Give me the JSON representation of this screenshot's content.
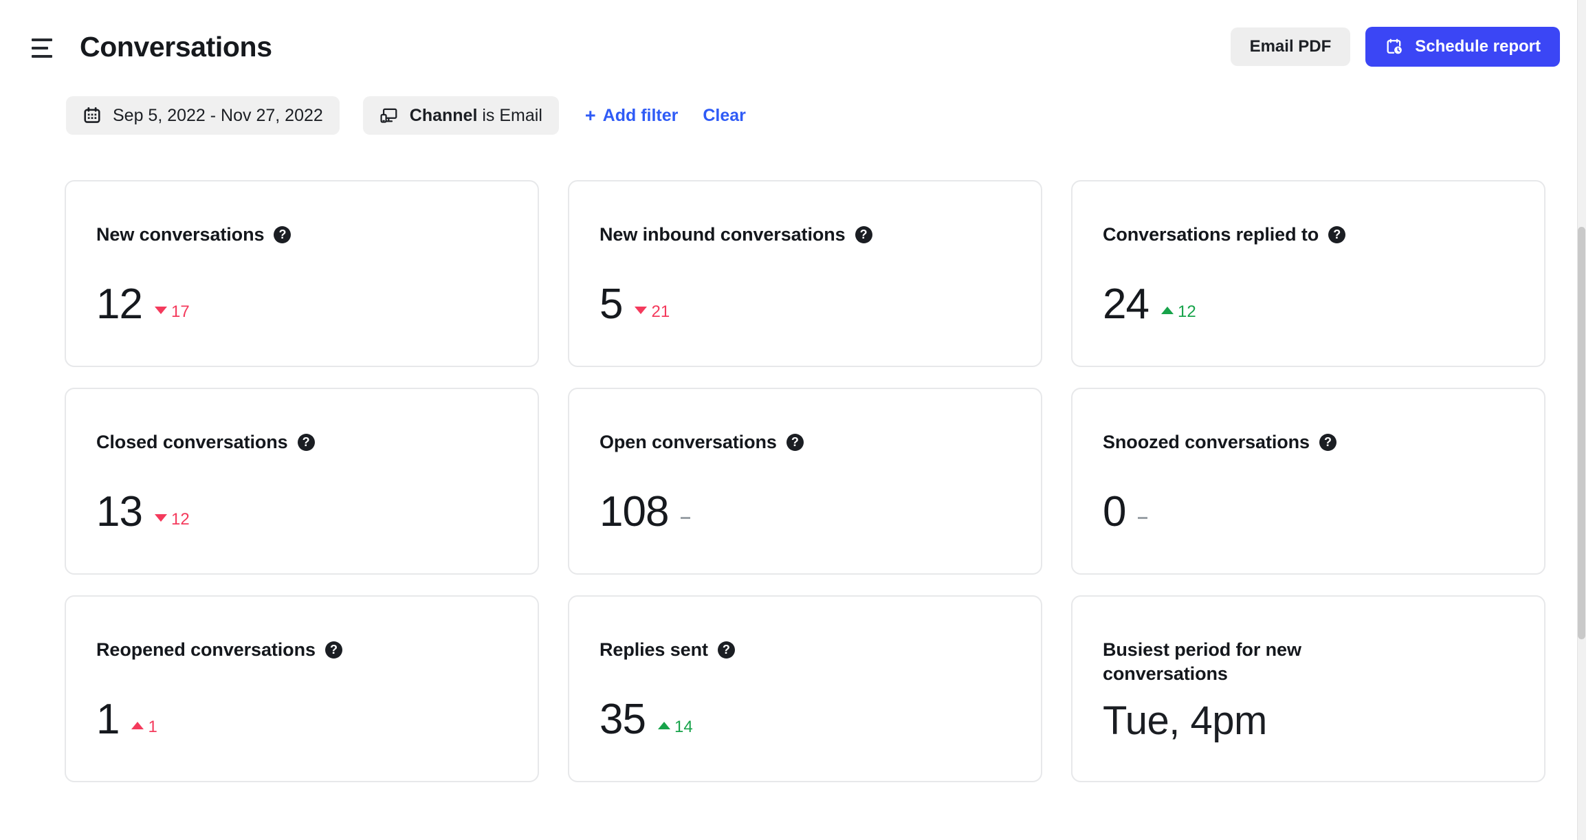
{
  "header": {
    "menu_icon": "hamburger-menu-icon",
    "title": "Conversations",
    "email_pdf_label": "Email PDF",
    "schedule_report_label": "Schedule report",
    "schedule_report_icon": "calendar-clock-icon",
    "primary_color": "#3b46f5"
  },
  "filters": {
    "date_range": "Sep 5, 2022 - Nov 27, 2022",
    "date_icon": "calendar-icon",
    "channel_icon": "devices-icon",
    "channel_key": "Channel",
    "channel_value": "is Email",
    "add_filter_label": "Add filter",
    "add_filter_plus": "+",
    "clear_label": "Clear",
    "link_color": "#2f5bf6"
  },
  "colors": {
    "increase_good": "#17a34a",
    "decrease_bad": "#f43a5c",
    "increase_bad": "#f43a5c",
    "neutral": "#9aa0a6"
  },
  "cards": [
    {
      "title": "New conversations",
      "help_icon": "help-circle-icon",
      "value": "12",
      "delta": "17",
      "direction": "down",
      "tone": "down"
    },
    {
      "title": "New inbound conversations",
      "help_icon": "help-circle-icon",
      "value": "5",
      "delta": "21",
      "direction": "down",
      "tone": "down"
    },
    {
      "title": "Conversations replied to",
      "help_icon": "help-circle-icon",
      "value": "24",
      "delta": "12",
      "direction": "up",
      "tone": "up"
    },
    {
      "title": "Closed conversations",
      "help_icon": "help-circle-icon",
      "value": "13",
      "delta": "12",
      "direction": "down",
      "tone": "down"
    },
    {
      "title": "Open conversations",
      "help_icon": "help-circle-icon",
      "value": "108",
      "delta": "",
      "direction": "flat",
      "tone": "flat"
    },
    {
      "title": "Snoozed conversations",
      "help_icon": "help-circle-icon",
      "value": "0",
      "delta": "",
      "direction": "flat",
      "tone": "flat"
    },
    {
      "title": "Reopened conversations",
      "help_icon": "help-circle-icon",
      "value": "1",
      "delta": "1",
      "direction": "up",
      "tone": "up-bad"
    },
    {
      "title": "Replies sent",
      "help_icon": "help-circle-icon",
      "value": "35",
      "delta": "14",
      "direction": "up",
      "tone": "up"
    },
    {
      "title": "Busiest period for new conversations",
      "help_icon": null,
      "value": "Tue, 4pm",
      "delta": "",
      "direction": "none",
      "tone": "none"
    }
  ]
}
